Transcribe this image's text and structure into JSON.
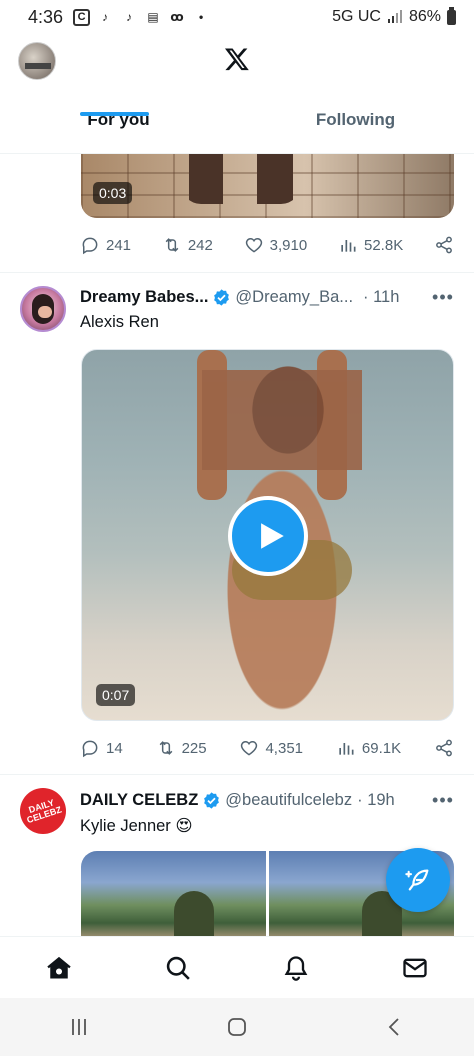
{
  "status_bar": {
    "time": "4:36",
    "network": "5G UC",
    "battery": "86%",
    "icons": [
      "c-badge-icon",
      "tiktok-icon",
      "tiktok-icon",
      "news-icon",
      "voicemail-icon",
      "dot-icon"
    ]
  },
  "header": {
    "logo": "x-logo-icon",
    "tabs": [
      {
        "label": "For you",
        "active": true
      },
      {
        "label": "Following",
        "active": false
      }
    ]
  },
  "prev_tweet": {
    "duration": "0:03",
    "actions": {
      "replies": "241",
      "reposts": "242",
      "likes": "3,910",
      "views": "52.8K"
    }
  },
  "tweet_1": {
    "name": "Dreamy Babes...",
    "handle": "@Dreamy_Ba...",
    "time": "· 11h",
    "text": "Alexis Ren",
    "duration": "0:07",
    "actions": {
      "replies": "14",
      "reposts": "225",
      "likes": "4,351",
      "views": "69.1K"
    }
  },
  "tweet_2": {
    "name": "DAILY CELEBZ",
    "handle": "@beautifulcelebz",
    "time": "· 19h",
    "text": "Kylie Jenner 😍",
    "avatar_text": "DAILY CELEBZ"
  },
  "colors": {
    "accent": "#1d9bf0",
    "text": "#0f1419",
    "secondary": "#536471"
  }
}
